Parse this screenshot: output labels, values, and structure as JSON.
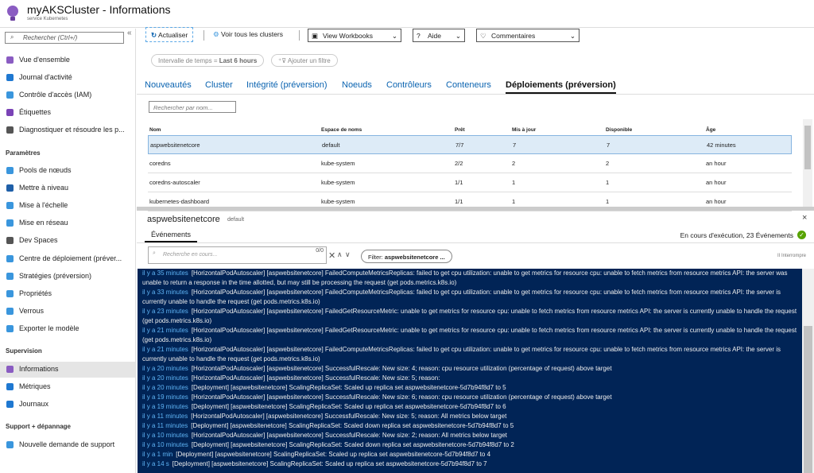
{
  "header": {
    "title": "myAKSCluster - Informations",
    "subtitle": "service Kubernetes"
  },
  "sidebar": {
    "search_placeholder": "Rechercher (Ctrl+/)",
    "collapse": "«",
    "items": [
      {
        "label": "Vue d'ensemble",
        "icon": "overview-icon",
        "color": "#8a5cc2"
      },
      {
        "label": "Journal d'activité",
        "icon": "activity-log-icon",
        "color": "#1f78d1"
      },
      {
        "label": "Contrôle d'accès (IAM)",
        "icon": "iam-icon",
        "color": "#3a96dd"
      },
      {
        "label": "Étiquettes",
        "icon": "tag-icon",
        "color": "#7a43b6"
      },
      {
        "label": "Diagnostiquer et résoudre les p...",
        "icon": "wrench-icon",
        "color": "#555555"
      }
    ],
    "sections": [
      {
        "title": "Paramètres",
        "items": [
          {
            "label": "Pools de nœuds",
            "icon": "node-pools-icon",
            "color": "#3a96dd"
          },
          {
            "label": "Mettre à niveau",
            "icon": "upgrade-icon",
            "color": "#1f5fa8"
          },
          {
            "label": "Mise à l'échelle",
            "icon": "scale-icon",
            "color": "#3a96dd"
          },
          {
            "label": "Mise en réseau",
            "icon": "network-icon",
            "color": "#3a96dd"
          },
          {
            "label": "Dev Spaces",
            "icon": "dev-spaces-icon",
            "color": "#555555"
          },
          {
            "label": "Centre de déploiement (préver...",
            "icon": "deployment-center-icon",
            "color": "#3a96dd"
          },
          {
            "label": "Stratégies (préversion)",
            "icon": "policy-icon",
            "color": "#3a96dd"
          },
          {
            "label": "Propriétés",
            "icon": "properties-icon",
            "color": "#3a96dd"
          },
          {
            "label": "Verrous",
            "icon": "lock-icon",
            "color": "#3a96dd"
          },
          {
            "label": "Exporter le modèle",
            "icon": "export-template-icon",
            "color": "#3a96dd"
          }
        ]
      },
      {
        "title": "Supervision",
        "items": [
          {
            "label": "Informations",
            "icon": "insights-icon",
            "color": "#8a5cc2",
            "selected": true
          },
          {
            "label": "Métriques",
            "icon": "metrics-icon",
            "color": "#1f78d1"
          },
          {
            "label": "Journaux",
            "icon": "logs-icon",
            "color": "#1f78d1"
          }
        ]
      },
      {
        "title": "Support + dépannage",
        "items": [
          {
            "label": "Nouvelle demande de support",
            "icon": "support-icon",
            "color": "#3a96dd"
          }
        ]
      }
    ]
  },
  "toolbar": {
    "refresh": "Actualiser",
    "view_clusters": "Voir tous les clusters",
    "workbooks": "View Workbooks",
    "help": "Aide",
    "feedback": "Commentaires"
  },
  "filters": {
    "time_label": "Intervalle de temps = ",
    "time_value": "Last 6 hours",
    "add_filter": "Ajouter un filtre"
  },
  "tabs": [
    "Nouveautés",
    "Cluster",
    "Intégrité (préversion)",
    "Noeuds",
    "Contrôleurs",
    "Conteneurs",
    "Déploiements (préversion)"
  ],
  "grid": {
    "search_placeholder": "Rechercher par nom...",
    "columns": [
      "Nom",
      "Espace de noms",
      "Prêt",
      "Mis à jour",
      "Disponible",
      "Âge"
    ],
    "rows": [
      [
        "aspwebsitenetcore",
        "default",
        "7/7",
        "7",
        "7",
        "42 minutes"
      ],
      [
        "coredns",
        "kube-system",
        "2/2",
        "2",
        "2",
        "an hour"
      ],
      [
        "coredns-autoscaler",
        "kube-system",
        "1/1",
        "1",
        "1",
        "an hour"
      ],
      [
        "kubernetes-dashboard",
        "kube-system",
        "1/1",
        "1",
        "1",
        "an hour"
      ]
    ]
  },
  "detail": {
    "name": "aspwebsitenetcore",
    "namespace": "default",
    "tab": "Événements",
    "status": "En cours d'exécution, 23 Événements",
    "search_placeholder": "Recherche en cours...",
    "count": "0/0",
    "filter_label": "Filter: ",
    "filter_value": "aspwebsitenetcore ...",
    "pause": "II Interrompre",
    "status_color": "#57a300"
  },
  "events": [
    {
      "time": "il y a 35 minutes",
      "text": "[HorizontalPodAutoscaler] [aspwebsitenetcore] FailedComputeMetricsReplicas: failed to get cpu utilization: unable to get metrics for resource cpu: unable to fetch metrics from resource metrics API: the server was unable to return a response in the time allotted, but may still be processing the request (get pods.metrics.k8s.io)"
    },
    {
      "time": "il y a 33 minutes",
      "text": "[HorizontalPodAutoscaler] [aspwebsitenetcore] FailedComputeMetricsReplicas: failed to get cpu utilization: unable to get metrics for resource cpu: unable to fetch metrics from resource metrics API: the server is currently unable to handle the request (get pods.metrics.k8s.io)"
    },
    {
      "time": "il y a 23 minutes",
      "text": "[HorizontalPodAutoscaler] [aspwebsitenetcore] FailedGetResourceMetric: unable to get metrics for resource cpu: unable to fetch metrics from resource metrics API: the server is currently unable to handle the request (get pods.metrics.k8s.io)"
    },
    {
      "time": "il y a 21 minutes",
      "text": "[HorizontalPodAutoscaler] [aspwebsitenetcore] FailedGetResourceMetric: unable to get metrics for resource cpu: unable to fetch metrics from resource metrics API: the server is currently unable to handle the request (get pods.metrics.k8s.io)"
    },
    {
      "time": "il y a 21 minutes",
      "text": "[HorizontalPodAutoscaler] [aspwebsitenetcore] FailedComputeMetricsReplicas: failed to get cpu utilization: unable to get metrics for resource cpu: unable to fetch metrics from resource metrics API: the server is currently unable to handle the request (get pods.metrics.k8s.io)"
    },
    {
      "time": "il y a 20 minutes",
      "text": "[HorizontalPodAutoscaler] [aspwebsitenetcore] SuccessfulRescale: New size: 4; reason: cpu resource utilization (percentage of request) above target"
    },
    {
      "time": "il y a 20 minutes",
      "text": "[HorizontalPodAutoscaler] [aspwebsitenetcore] SuccessfulRescale: New size: 5; reason:"
    },
    {
      "time": "il y a 20 minutes",
      "text": "[Deployment] [aspwebsitenetcore] ScalingReplicaSet: Scaled up replica set aspwebsitenetcore-5d7b94f8d7 to 5"
    },
    {
      "time": "il y a 19 minutes",
      "text": "[HorizontalPodAutoscaler] [aspwebsitenetcore] SuccessfulRescale: New size: 6; reason: cpu resource utilization (percentage of request) above target"
    },
    {
      "time": "il y a 19 minutes",
      "text": "[Deployment] [aspwebsitenetcore] ScalingReplicaSet: Scaled up replica set aspwebsitenetcore-5d7b94f8d7 to 6"
    },
    {
      "time": "il y a 11 minutes",
      "text": "[HorizontalPodAutoscaler] [aspwebsitenetcore] SuccessfulRescale: New size: 5; reason: All metrics below target"
    },
    {
      "time": "il y a 11 minutes",
      "text": "[Deployment] [aspwebsitenetcore] ScalingReplicaSet: Scaled down replica set aspwebsitenetcore-5d7b94f8d7 to 5"
    },
    {
      "time": "il y a 10 minutes",
      "text": "[HorizontalPodAutoscaler] [aspwebsitenetcore] SuccessfulRescale: New size: 2; reason: All metrics below target"
    },
    {
      "time": "il y a 10 minutes",
      "text": "[Deployment] [aspwebsitenetcore] ScalingReplicaSet: Scaled down replica set aspwebsitenetcore-5d7b94f8d7 to 2"
    },
    {
      "time": "il y a 1 min",
      "text": "[Deployment] [aspwebsitenetcore] ScalingReplicaSet: Scaled up replica set aspwebsitenetcore-5d7b94f8d7 to 4"
    },
    {
      "time": "il y a 14 s",
      "text": "[Deployment] [aspwebsitenetcore] ScalingReplicaSet: Scaled up replica set aspwebsitenetcore-5d7b94f8d7 to 7"
    }
  ]
}
